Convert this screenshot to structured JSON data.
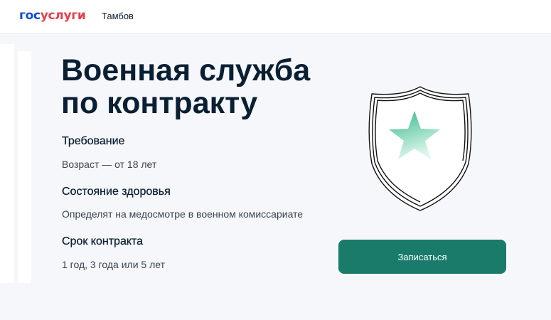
{
  "header": {
    "logo": {
      "part1": "гос",
      "part2": "услуги"
    },
    "region": "Тамбов"
  },
  "main": {
    "title_line1": "Военная служба",
    "title_line2": "по контракту",
    "sections": [
      {
        "heading": "Требование",
        "text": "Возраст — от 18 лет"
      },
      {
        "heading": "Состояние здоровья",
        "text": "Определят на медосмотре в военном комиссариате"
      },
      {
        "heading": "Срок контракта",
        "text": "1 год, 3 года или 5 лет"
      }
    ],
    "cta_label": "Записаться"
  },
  "colors": {
    "logo_blue": "#0d4cd3",
    "logo_red": "#e3404e",
    "button": "#1b7b6a",
    "star": "#59c9a5"
  },
  "icons": {
    "illustration": "shield-star-icon"
  }
}
